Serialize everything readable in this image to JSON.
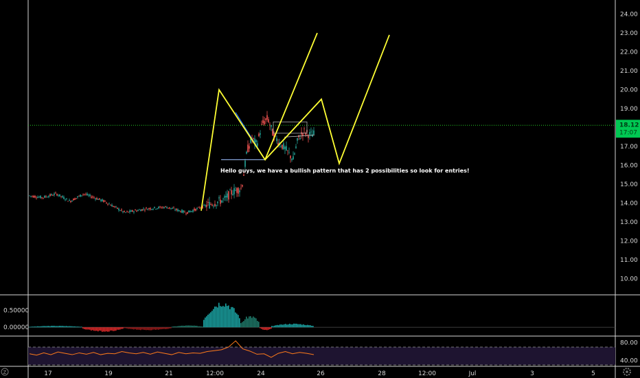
{
  "chart_data": {
    "type": "candlestick",
    "main": {
      "y_ticks": [
        "24.00",
        "23.00",
        "22.00",
        "21.00",
        "20.00",
        "19.00",
        "18.00",
        "17.00",
        "16.00",
        "15.00",
        "14.00",
        "13.00",
        "12.00",
        "11.00",
        "10.00"
      ],
      "ylim": [
        9.3,
        24.6
      ],
      "current_price": "18.12",
      "countdown": "17:07",
      "current_price_value": 18.12,
      "price_path": [
        [
          0,
          14.4
        ],
        [
          20,
          14.3
        ],
        [
          40,
          14.5
        ],
        [
          60,
          14.1
        ],
        [
          80,
          14.5
        ],
        [
          110,
          14.1
        ],
        [
          140,
          13.5
        ],
        [
          170,
          13.7
        ],
        [
          200,
          13.8
        ],
        [
          230,
          13.5
        ],
        [
          260,
          13.9
        ],
        [
          285,
          14.2
        ],
        [
          296,
          14.6
        ],
        [
          310,
          14.8
        ],
        [
          318,
          16.8
        ],
        [
          325,
          17.4
        ],
        [
          332,
          17.1
        ],
        [
          340,
          18.2
        ],
        [
          348,
          18.5
        ],
        [
          356,
          17.6
        ],
        [
          365,
          17.2
        ],
        [
          375,
          16.8
        ],
        [
          385,
          16.3
        ],
        [
          392,
          17.4
        ],
        [
          400,
          17.8
        ],
        [
          410,
          17.6
        ],
        [
          420,
          17.7
        ],
        [
          430,
          17.5
        ],
        [
          440,
          17.6
        ],
        [
          450,
          17.7
        ],
        [
          457,
          17.9
        ]
      ],
      "annotation_text": "Hello guys, we have a bullish pattern that has 2 possibilities so look for entries!",
      "projection_1": [
        [
          293,
          13.6
        ],
        [
          319,
          20.0
        ],
        [
          386,
          16.3
        ],
        [
          462,
          23.0
        ]
      ],
      "projection_2": [
        [
          386,
          16.3
        ],
        [
          468,
          19.5
        ],
        [
          494,
          16.1
        ],
        [
          567,
          22.9
        ]
      ],
      "flag_triangle": [
        [
          343,
          18.8
        ],
        [
          386,
          16.3
        ],
        [
          322,
          16.3
        ]
      ],
      "rectangle": {
        "from": [
          398,
          18.3
        ],
        "to": [
          447,
          17.7
        ]
      }
    },
    "oscillator": {
      "y_ticks": [
        "0.50000",
        "0.00000"
      ],
      "ylim": [
        -0.2,
        0.9
      ],
      "series": [
        {
          "from": 42,
          "to": 120,
          "value": 0.04,
          "color": "#1aa3a3"
        },
        {
          "from": 120,
          "to": 180,
          "value": -0.12,
          "color": "#e22a2a"
        },
        {
          "from": 180,
          "to": 250,
          "value": -0.08,
          "color": "#9b1a1a"
        },
        {
          "from": 250,
          "to": 296,
          "value": 0.05,
          "color": "#1f7a6a"
        },
        {
          "from": 296,
          "to": 350,
          "value": 0.72,
          "color": "#1aa3a3"
        },
        {
          "from": 350,
          "to": 378,
          "value": 0.32,
          "color": "#1f7a6a"
        },
        {
          "from": 378,
          "to": 395,
          "value": -0.08,
          "color": "#e22a2a"
        },
        {
          "from": 395,
          "to": 457,
          "value": 0.1,
          "color": "#1aa3a3"
        }
      ]
    },
    "rsi": {
      "y_ticks": [
        "80.00",
        "40.00"
      ],
      "ylim": [
        30,
        90
      ],
      "upper": 70,
      "lower": 30,
      "values": [
        55,
        52,
        57,
        53,
        59,
        56,
        53,
        57,
        54,
        58,
        53,
        56,
        55,
        60,
        57,
        55,
        58,
        54,
        59,
        56,
        53,
        58,
        55,
        57,
        56,
        60,
        62,
        64,
        70,
        84,
        66,
        61,
        54,
        55,
        47,
        56,
        60,
        55,
        58,
        56,
        53
      ]
    },
    "x_ticks": [
      "17",
      "19",
      "21",
      "12:00",
      "24",
      "26",
      "28",
      "12:00",
      "Jul",
      "3",
      "5"
    ],
    "colors": {
      "up": "#26a69a",
      "down": "#ef5350",
      "projection": "#ffff33",
      "flag": "#2979ff",
      "price_line": "#26d026",
      "price_label_bg": "#00c853",
      "rsi_line": "#ff7b1a",
      "rsi_band": "#1e1430"
    }
  },
  "corner": {
    "timezone_icon_label": "Z",
    "settings_icon_name": "gear-icon"
  }
}
